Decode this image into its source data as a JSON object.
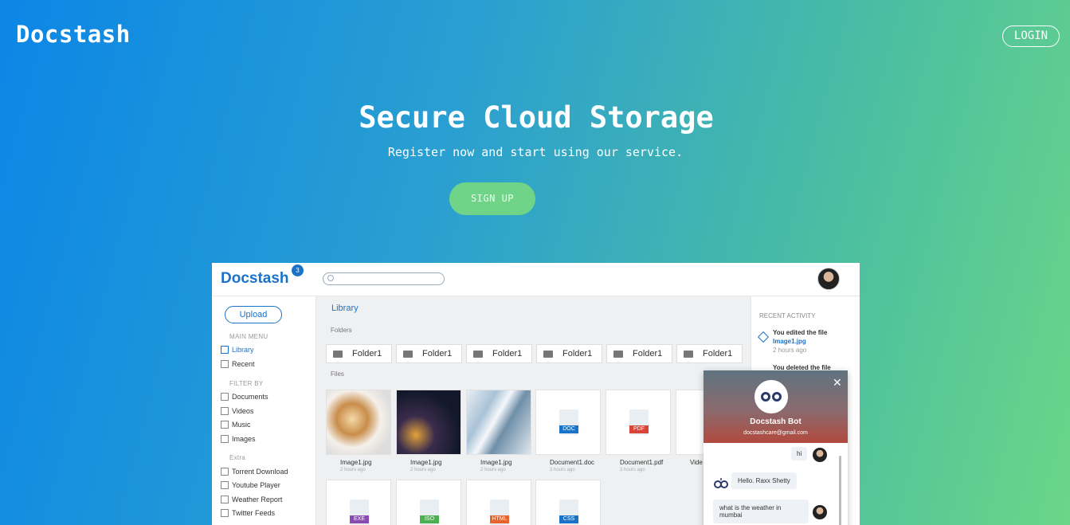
{
  "header": {
    "brand": "Docstash",
    "login_label": "LOGIN"
  },
  "hero": {
    "title": "Secure Cloud Storage",
    "subtitle": "Register now and start using our service.",
    "signup_label": "SIGN UP"
  },
  "preview": {
    "logo": "Docstash",
    "badge": "3",
    "upload_label": "Upload",
    "main_menu_label": "MAIN MENU",
    "filter_label": "FILTER BY",
    "extra_label": "Extra",
    "menu": [
      "Library",
      "Recent"
    ],
    "filters": [
      "Documents",
      "Videos",
      "Music",
      "Images"
    ],
    "extras": [
      "Torrent Download",
      "Youtube Player",
      "Weather Report",
      "Twitter Feeds"
    ],
    "library_title": "Library",
    "folders_label": "Folders",
    "files_label": "Files",
    "folders": [
      "Folder1",
      "Folder1",
      "Folder1",
      "Folder1",
      "Folder1",
      "Folder1"
    ],
    "files": [
      {
        "name": "Image1.jpg",
        "time": "2 hours ago"
      },
      {
        "name": "Image1.jpg",
        "time": "2 hours ago"
      },
      {
        "name": "Image1.jpg",
        "time": "2 hours ago"
      },
      {
        "name": "Document1.doc",
        "time": "2 hours ago",
        "tag": "DOC"
      },
      {
        "name": "Document1.pdf",
        "time": "2 hours ago",
        "tag": "PDF"
      },
      {
        "name": "Vide",
        "time": ""
      }
    ],
    "files_row2": [
      "EXE",
      "ISO",
      "HTML",
      "CSS"
    ],
    "activity": {
      "title": "RECENT ACTIVITY",
      "item1": "You edited the file",
      "item1_link": "Image1.jpg",
      "item1_time": "2 hours ago",
      "item2": "You deleted the file"
    }
  },
  "chat": {
    "name": "Docstash Bot",
    "email": "docstashcare@gmail.com",
    "msg_user1": "hi",
    "msg_bot1": "Hello. Raxx Shetty",
    "msg_user2": "what is the weather in mumbai"
  },
  "colors": {
    "accent": "#1a73c9",
    "signup": "#6fd487"
  }
}
